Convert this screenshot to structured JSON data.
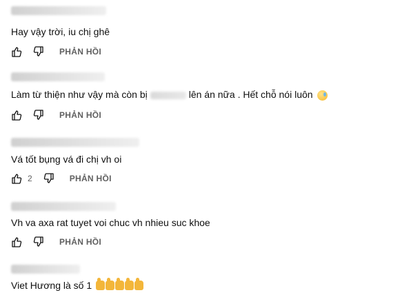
{
  "comments": [
    {
      "text": "Hay vậy trời, iu chị ghê",
      "like_count": "",
      "reply_label": "PHẢN HỒI"
    },
    {
      "text_before": "Làm từ thiện như vậy mà còn bị",
      "text_after": "lên án  nữa . Hết chỗ nói luôn",
      "like_count": "",
      "reply_label": "PHẢN HỒI"
    },
    {
      "text": "Vá tốt bụng vá đi chị vh oi",
      "like_count": "2",
      "reply_label": "PHẢN HỒI"
    },
    {
      "text": "Vh va axa rat tuyet voi chuc vh nhieu suc khoe",
      "like_count": "",
      "reply_label": "PHẢN HỒI"
    },
    {
      "text": "Viet Hương là số 1",
      "like_count": "",
      "reply_label": ""
    }
  ],
  "icons": {
    "like": "thumbs-up-outline-icon",
    "dislike": "thumbs-down-outline-icon",
    "emoji_sad": "sad-face-emoji",
    "emoji_thumbs": "thumbs-up-emoji"
  },
  "colors": {
    "text": "#0f0f0f",
    "secondary": "#606060",
    "background": "#ffffff"
  }
}
